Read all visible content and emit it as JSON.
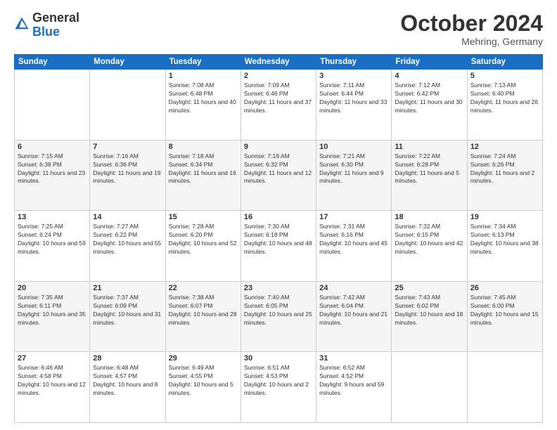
{
  "header": {
    "logo_general": "General",
    "logo_blue": "Blue",
    "month": "October 2024",
    "location": "Mehring, Germany"
  },
  "weekdays": [
    "Sunday",
    "Monday",
    "Tuesday",
    "Wednesday",
    "Thursday",
    "Friday",
    "Saturday"
  ],
  "weeks": [
    [
      {
        "day": "",
        "sunrise": "",
        "sunset": "",
        "daylight": ""
      },
      {
        "day": "",
        "sunrise": "",
        "sunset": "",
        "daylight": ""
      },
      {
        "day": "1",
        "sunrise": "Sunrise: 7:08 AM",
        "sunset": "Sunset: 6:48 PM",
        "daylight": "Daylight: 11 hours and 40 minutes."
      },
      {
        "day": "2",
        "sunrise": "Sunrise: 7:09 AM",
        "sunset": "Sunset: 6:46 PM",
        "daylight": "Daylight: 11 hours and 37 minutes."
      },
      {
        "day": "3",
        "sunrise": "Sunrise: 7:11 AM",
        "sunset": "Sunset: 6:44 PM",
        "daylight": "Daylight: 11 hours and 33 minutes."
      },
      {
        "day": "4",
        "sunrise": "Sunrise: 7:12 AM",
        "sunset": "Sunset: 6:42 PM",
        "daylight": "Daylight: 11 hours and 30 minutes."
      },
      {
        "day": "5",
        "sunrise": "Sunrise: 7:13 AM",
        "sunset": "Sunset: 6:40 PM",
        "daylight": "Daylight: 11 hours and 26 minutes."
      }
    ],
    [
      {
        "day": "6",
        "sunrise": "Sunrise: 7:15 AM",
        "sunset": "Sunset: 6:38 PM",
        "daylight": "Daylight: 11 hours and 23 minutes."
      },
      {
        "day": "7",
        "sunrise": "Sunrise: 7:16 AM",
        "sunset": "Sunset: 6:36 PM",
        "daylight": "Daylight: 11 hours and 19 minutes."
      },
      {
        "day": "8",
        "sunrise": "Sunrise: 7:18 AM",
        "sunset": "Sunset: 6:34 PM",
        "daylight": "Daylight: 11 hours and 16 minutes."
      },
      {
        "day": "9",
        "sunrise": "Sunrise: 7:19 AM",
        "sunset": "Sunset: 6:32 PM",
        "daylight": "Daylight: 11 hours and 12 minutes."
      },
      {
        "day": "10",
        "sunrise": "Sunrise: 7:21 AM",
        "sunset": "Sunset: 6:30 PM",
        "daylight": "Daylight: 11 hours and 9 minutes."
      },
      {
        "day": "11",
        "sunrise": "Sunrise: 7:22 AM",
        "sunset": "Sunset: 6:28 PM",
        "daylight": "Daylight: 11 hours and 5 minutes."
      },
      {
        "day": "12",
        "sunrise": "Sunrise: 7:24 AM",
        "sunset": "Sunset: 6:26 PM",
        "daylight": "Daylight: 11 hours and 2 minutes."
      }
    ],
    [
      {
        "day": "13",
        "sunrise": "Sunrise: 7:25 AM",
        "sunset": "Sunset: 6:24 PM",
        "daylight": "Daylight: 10 hours and 59 minutes."
      },
      {
        "day": "14",
        "sunrise": "Sunrise: 7:27 AM",
        "sunset": "Sunset: 6:22 PM",
        "daylight": "Daylight: 10 hours and 55 minutes."
      },
      {
        "day": "15",
        "sunrise": "Sunrise: 7:28 AM",
        "sunset": "Sunset: 6:20 PM",
        "daylight": "Daylight: 10 hours and 52 minutes."
      },
      {
        "day": "16",
        "sunrise": "Sunrise: 7:30 AM",
        "sunset": "Sunset: 6:18 PM",
        "daylight": "Daylight: 10 hours and 48 minutes."
      },
      {
        "day": "17",
        "sunrise": "Sunrise: 7:31 AM",
        "sunset": "Sunset: 6:16 PM",
        "daylight": "Daylight: 10 hours and 45 minutes."
      },
      {
        "day": "18",
        "sunrise": "Sunrise: 7:32 AM",
        "sunset": "Sunset: 6:15 PM",
        "daylight": "Daylight: 10 hours and 42 minutes."
      },
      {
        "day": "19",
        "sunrise": "Sunrise: 7:34 AM",
        "sunset": "Sunset: 6:13 PM",
        "daylight": "Daylight: 10 hours and 38 minutes."
      }
    ],
    [
      {
        "day": "20",
        "sunrise": "Sunrise: 7:35 AM",
        "sunset": "Sunset: 6:11 PM",
        "daylight": "Daylight: 10 hours and 35 minutes."
      },
      {
        "day": "21",
        "sunrise": "Sunrise: 7:37 AM",
        "sunset": "Sunset: 6:09 PM",
        "daylight": "Daylight: 10 hours and 31 minutes."
      },
      {
        "day": "22",
        "sunrise": "Sunrise: 7:38 AM",
        "sunset": "Sunset: 6:07 PM",
        "daylight": "Daylight: 10 hours and 28 minutes."
      },
      {
        "day": "23",
        "sunrise": "Sunrise: 7:40 AM",
        "sunset": "Sunset: 6:05 PM",
        "daylight": "Daylight: 10 hours and 25 minutes."
      },
      {
        "day": "24",
        "sunrise": "Sunrise: 7:42 AM",
        "sunset": "Sunset: 6:04 PM",
        "daylight": "Daylight: 10 hours and 21 minutes."
      },
      {
        "day": "25",
        "sunrise": "Sunrise: 7:43 AM",
        "sunset": "Sunset: 6:02 PM",
        "daylight": "Daylight: 10 hours and 18 minutes."
      },
      {
        "day": "26",
        "sunrise": "Sunrise: 7:45 AM",
        "sunset": "Sunset: 6:00 PM",
        "daylight": "Daylight: 10 hours and 15 minutes."
      }
    ],
    [
      {
        "day": "27",
        "sunrise": "Sunrise: 6:46 AM",
        "sunset": "Sunset: 4:58 PM",
        "daylight": "Daylight: 10 hours and 12 minutes."
      },
      {
        "day": "28",
        "sunrise": "Sunrise: 6:48 AM",
        "sunset": "Sunset: 4:57 PM",
        "daylight": "Daylight: 10 hours and 8 minutes."
      },
      {
        "day": "29",
        "sunrise": "Sunrise: 6:49 AM",
        "sunset": "Sunset: 4:55 PM",
        "daylight": "Daylight: 10 hours and 5 minutes."
      },
      {
        "day": "30",
        "sunrise": "Sunrise: 6:51 AM",
        "sunset": "Sunset: 4:53 PM",
        "daylight": "Daylight: 10 hours and 2 minutes."
      },
      {
        "day": "31",
        "sunrise": "Sunrise: 6:52 AM",
        "sunset": "Sunset: 4:52 PM",
        "daylight": "Daylight: 9 hours and 59 minutes."
      },
      {
        "day": "",
        "sunrise": "",
        "sunset": "",
        "daylight": ""
      },
      {
        "day": "",
        "sunrise": "",
        "sunset": "",
        "daylight": ""
      }
    ]
  ]
}
